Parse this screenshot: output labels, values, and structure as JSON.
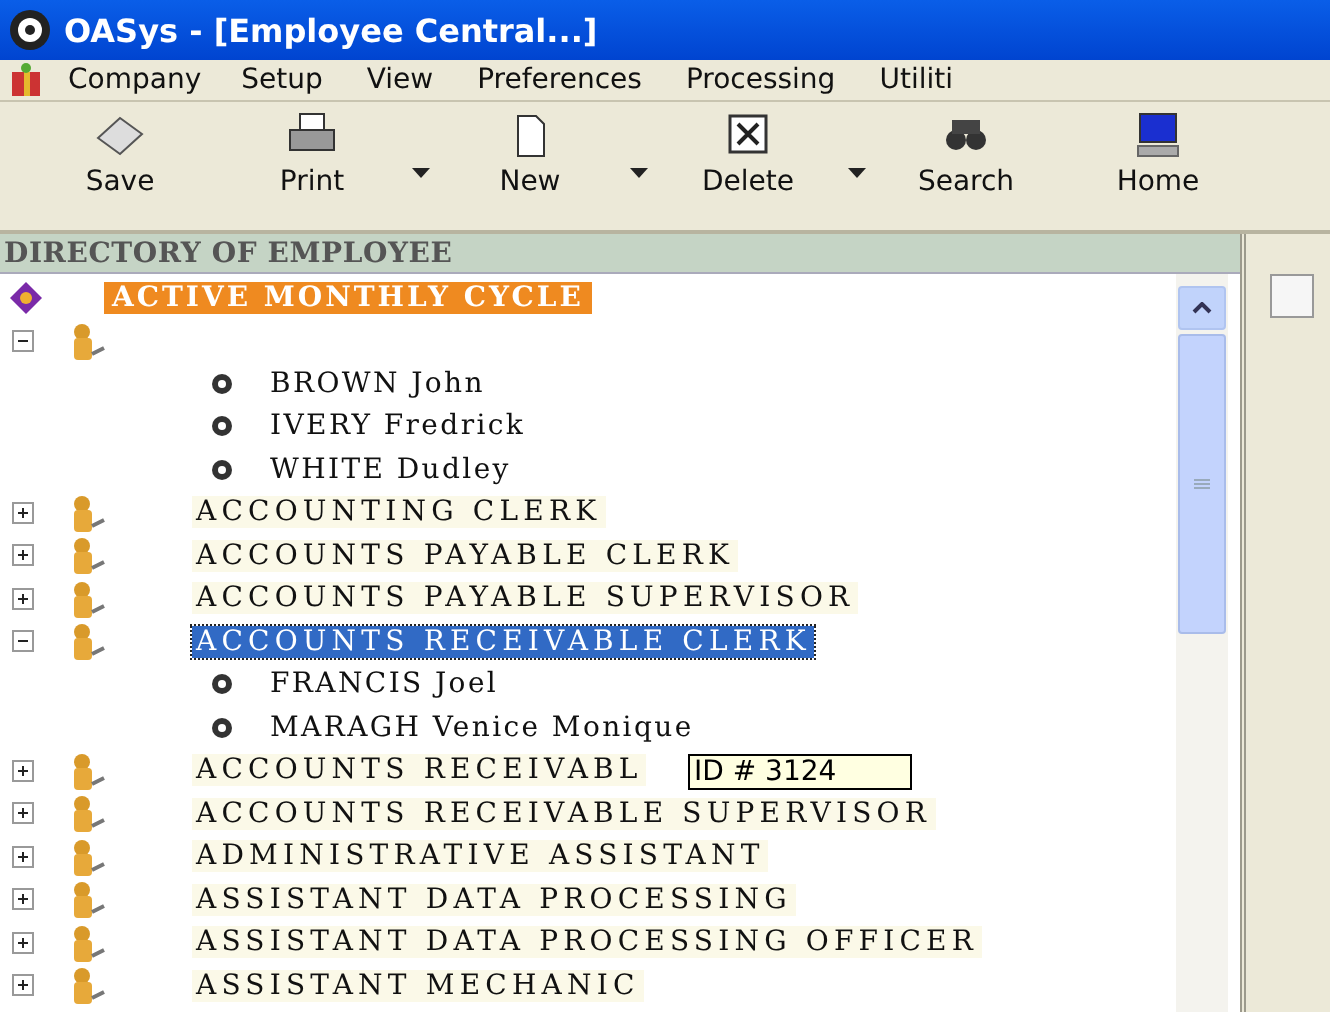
{
  "window": {
    "title": "OASys - [Employee Central...]"
  },
  "menu": [
    "Company",
    "Setup",
    "View",
    "Preferences",
    "Processing",
    "Utiliti"
  ],
  "toolbar": [
    {
      "label": "Save",
      "kind": "save",
      "has_menu": false
    },
    {
      "label": "Print",
      "kind": "print",
      "has_menu": true
    },
    {
      "label": "New",
      "kind": "new",
      "has_menu": true
    },
    {
      "label": "Delete",
      "kind": "delete",
      "has_menu": true
    },
    {
      "label": "Search",
      "kind": "search",
      "has_menu": false
    },
    {
      "label": "Home",
      "kind": "home",
      "has_menu": false
    }
  ],
  "directory": {
    "header": "DIRECTORY OF EMPLOYEE",
    "root": {
      "label": "ACTIVE MONTHLY CYCLE",
      "children": [
        {
          "expanded": true,
          "selected": false,
          "children": [
            {
              "label": "BROWN John"
            },
            {
              "label": "IVERY Fredrick"
            },
            {
              "label": "WHITE Dudley"
            }
          ]
        },
        {
          "label": "ACCOUNTING CLERK",
          "expanded": false,
          "selected": false
        },
        {
          "label": "ACCOUNTS PAYABLE CLERK",
          "expanded": false,
          "selected": false
        },
        {
          "label": "ACCOUNTS PAYABLE SUPERVISOR",
          "expanded": false,
          "selected": false
        },
        {
          "label": "ACCOUNTS RECEIVABLE CLERK",
          "expanded": true,
          "selected": true,
          "children": [
            {
              "label": "FRANCIS Joel"
            },
            {
              "label": "MARAGH Venice Monique"
            }
          ]
        },
        {
          "label": "ACCOUNTS RECEIVABL",
          "expanded": false,
          "selected": false,
          "tooltip": "ID # 3124"
        },
        {
          "label": "ACCOUNTS RECEIVABLE SUPERVISOR",
          "expanded": false,
          "selected": false
        },
        {
          "label": "ADMINISTRATIVE ASSISTANT",
          "expanded": false,
          "selected": false
        },
        {
          "label": "ASSISTANT DATA PROCESSING",
          "expanded": false,
          "selected": false
        },
        {
          "label": "ASSISTANT DATA PROCESSING OFFICER",
          "expanded": false,
          "selected": false
        },
        {
          "label": "ASSISTANT MECHANIC",
          "expanded": false,
          "selected": false
        }
      ]
    }
  }
}
